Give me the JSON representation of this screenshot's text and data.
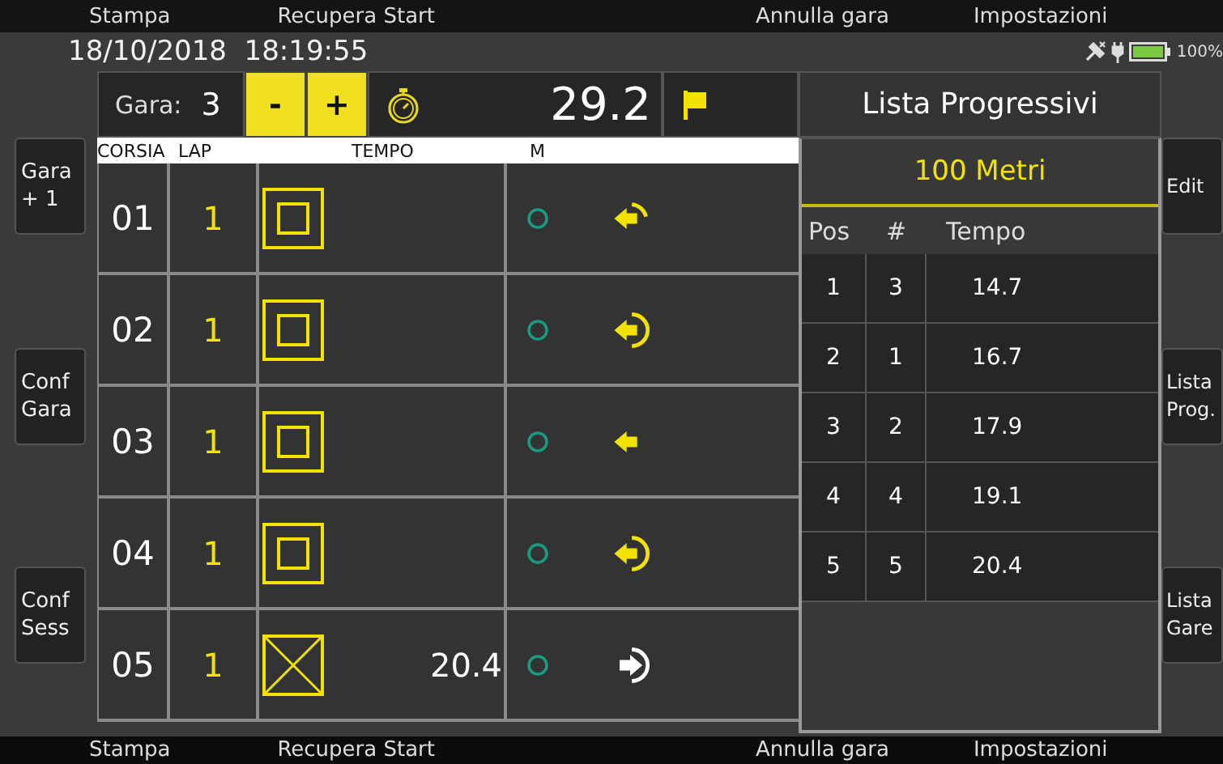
{
  "menu_bar": [
    "Stampa",
    "Recupera Start",
    "Annulla gara",
    "Impostazioni"
  ],
  "status_bar": {
    "datetime": "18/10/2018  18:19:55",
    "battery": "100%"
  },
  "left_buttons": [
    "Gara\n+ 1",
    "Conf\nGara",
    "Conf\nSess"
  ],
  "race_header": {
    "label": "Gara:",
    "value": "3",
    "buttons": [
      "-",
      "+"
    ],
    "timer": "29.2"
  },
  "lanes_table": {
    "columns": [
      "CORSIA",
      "LAP",
      "TEMPO",
      "M"
    ],
    "rows": [
      {
        "lane": "01",
        "lap": "1",
        "kind": "quarter"
      },
      {
        "lane": "02",
        "lap": "1",
        "kind": "half"
      },
      {
        "lane": "03",
        "lap": "1",
        "kind": "plain"
      },
      {
        "lane": "04",
        "lap": "1",
        "kind": "half"
      },
      {
        "lane": "05",
        "lap": "1",
        "kind": "finished",
        "time": "20.4"
      }
    ]
  },
  "progress_panel": {
    "title": "Lista Progressivi",
    "distance": "100 Metri",
    "columns": [
      "Pos",
      "#",
      "Tempo"
    ],
    "rows": [
      [
        "1",
        "3",
        "14.7"
      ],
      [
        "2",
        "1",
        "16.7"
      ],
      [
        "3",
        "2",
        "17.9"
      ],
      [
        "4",
        "4",
        "19.1"
      ],
      [
        "5",
        "5",
        "20.4"
      ]
    ]
  },
  "right_buttons": [
    "Edit",
    "Lista\nProg.",
    "Lista\nGare"
  ],
  "bottom_menu": [
    "Stampa",
    "Recupera Start",
    "Annulla gara",
    "Impostazioni"
  ]
}
